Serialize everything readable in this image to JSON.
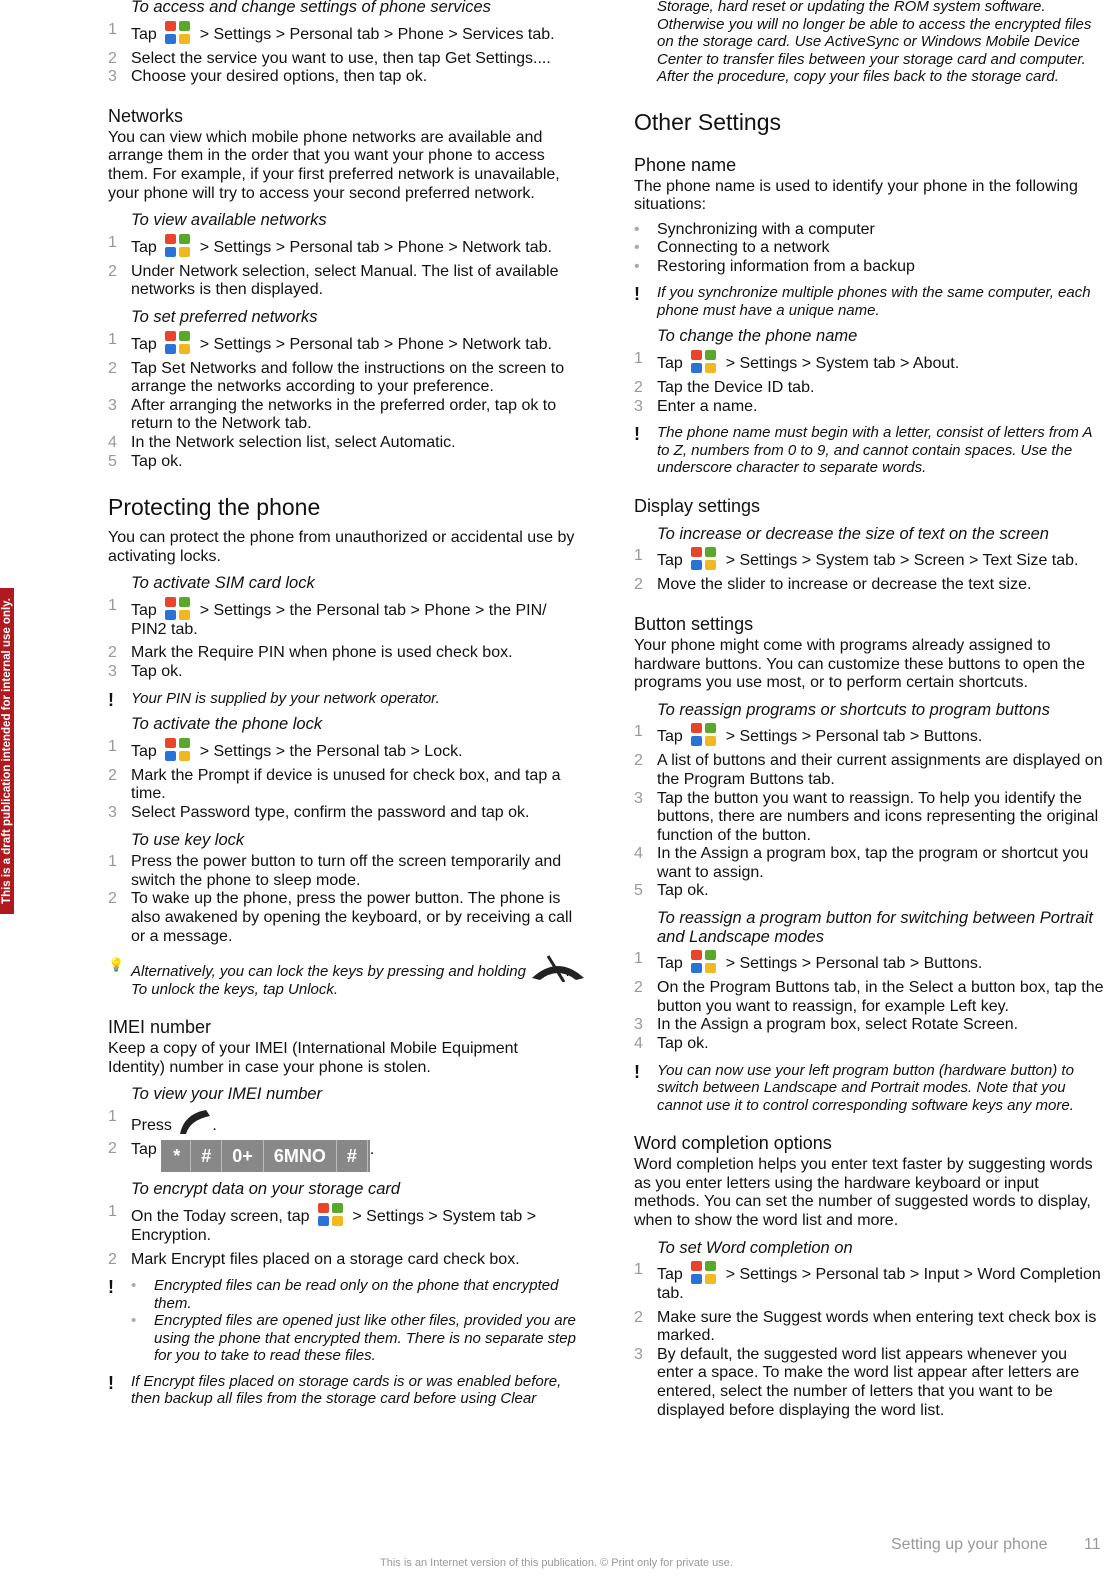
{
  "draft_banner": "This is a draft publication intended for internal use only.",
  "footer": {
    "section": "Setting up your phone",
    "page": "11",
    "note": "This is an Internet version of this publication. © Print only for private use."
  },
  "colors": {
    "draft": "#b01a1f",
    "muted": "#999999"
  },
  "left": [
    {
      "t": "task",
      "text": "To access and change settings of phone services",
      "first": true
    },
    {
      "t": "steps",
      "items": [
        [
          "Tap ",
          {
            "icon": "windows-start-icon"
          },
          " > Settings > Personal tab > Phone > Services tab."
        ],
        [
          "Select the service you want to use, then tap Get Settings...."
        ],
        [
          "Choose your desired options, then tap ok."
        ]
      ]
    },
    {
      "t": "h3",
      "text": "Networks"
    },
    {
      "t": "p",
      "text": "You can view which mobile phone networks are available and arrange them in the order that you want your phone to access them. For example, if your first preferred network is unavailable, your phone will try to access your second preferred network."
    },
    {
      "t": "task",
      "text": "To view available networks"
    },
    {
      "t": "steps",
      "items": [
        [
          "Tap ",
          {
            "icon": "windows-start-icon"
          },
          " > Settings > Personal tab > Phone > Network tab."
        ],
        [
          "Under Network selection, select Manual. The list of available networks is then displayed."
        ]
      ]
    },
    {
      "t": "task",
      "text": "To set preferred networks"
    },
    {
      "t": "steps",
      "items": [
        [
          "Tap ",
          {
            "icon": "windows-start-icon"
          },
          " > Settings > Personal tab > Phone > Network tab."
        ],
        [
          "Tap Set Networks and follow the instructions on the screen to arrange the networks according to your preference."
        ],
        [
          "After arranging the networks in the preferred order, tap ok to return to the Network tab."
        ],
        [
          "In the Network selection list, select Automatic."
        ],
        [
          "Tap ok."
        ]
      ]
    },
    {
      "t": "h2",
      "text": "Protecting the phone"
    },
    {
      "t": "p",
      "text": "You can protect the phone from unauthorized or accidental use by activating locks."
    },
    {
      "t": "task",
      "text": "To activate SIM card lock"
    },
    {
      "t": "steps",
      "items": [
        [
          "Tap ",
          {
            "icon": "windows-start-icon"
          },
          " > Settings > the Personal tab > Phone > the PIN/ PIN2 tab."
        ],
        [
          "Mark the Require PIN when phone is used check box."
        ],
        [
          "Tap ok."
        ]
      ]
    },
    {
      "t": "note",
      "text": "Your PIN is supplied by your network operator."
    },
    {
      "t": "task",
      "text": "To activate the phone lock"
    },
    {
      "t": "steps",
      "items": [
        [
          "Tap ",
          {
            "icon": "windows-start-icon"
          },
          " > Settings > the Personal tab > Lock."
        ],
        [
          "Mark the Prompt if device is unused for check box, and tap a time."
        ],
        [
          "Select Password type, confirm the password and tap ok."
        ]
      ]
    },
    {
      "t": "task",
      "text": "To use key lock"
    },
    {
      "t": "steps",
      "items": [
        [
          "Press the power button to turn off the screen temporarily and switch the phone to sleep mode."
        ],
        [
          "To wake up the phone, press the power button. The phone is also awakened by opening the keyboard, or by receiving a call or a message."
        ]
      ]
    },
    {
      "t": "tip",
      "parts": [
        "Alternatively, you can lock the keys by pressing and holding ",
        {
          "icon": "end-call-icon"
        },
        ". To unlock the keys, tap Unlock."
      ]
    },
    {
      "t": "h3",
      "text": "IMEI number"
    },
    {
      "t": "p",
      "text": "Keep a copy of your IMEI (International Mobile Equipment Identity) number in case your phone is stolen."
    },
    {
      "t": "task",
      "text": "To view your IMEI number"
    },
    {
      "t": "steps",
      "items": [
        [
          "Press ",
          {
            "icon": "call-icon"
          },
          "."
        ],
        [
          "Tap ",
          {
            "keys": [
              "*",
              "#",
              "0+",
              "6MNO",
              "#"
            ]
          },
          "."
        ]
      ]
    },
    {
      "t": "task",
      "text": "To encrypt data on your storage card"
    },
    {
      "t": "steps",
      "items": [
        [
          "On the Today screen, tap ",
          {
            "icon": "windows-start-icon"
          },
          " > Settings > System tab > Encryption."
        ],
        [
          "Mark Encrypt files placed on a storage card check box."
        ]
      ]
    },
    {
      "t": "note",
      "bullets": [
        "Encrypted files can be read only on the phone that encrypted them.",
        "Encrypted files are opened just like other files, provided you are using the phone that encrypted them. There is no separate step for you to take to read these files."
      ]
    },
    {
      "t": "note",
      "text": "If Encrypt files placed on storage cards is or was enabled before, then backup all files from the storage card before using Clear"
    }
  ],
  "right": [
    {
      "t": "cont",
      "text": "Storage, hard reset or updating the ROM system software. Otherwise you will no longer be able to access the encrypted files on the storage card. Use ActiveSync or Windows Mobile Device Center to transfer files between your storage card and computer. After the procedure, copy your files back to the storage card."
    },
    {
      "t": "h2",
      "text": "Other Settings"
    },
    {
      "t": "h3",
      "text": "Phone name"
    },
    {
      "t": "p",
      "text": "The phone name is used to identify your phone in the following situations:"
    },
    {
      "t": "bullets",
      "items": [
        "Synchronizing with a computer",
        "Connecting to a network",
        "Restoring information from a backup"
      ]
    },
    {
      "t": "note",
      "text": "If you synchronize multiple phones with the same computer, each phone must have a unique name."
    },
    {
      "t": "task",
      "text": "To change the phone name"
    },
    {
      "t": "steps",
      "items": [
        [
          "Tap ",
          {
            "icon": "windows-start-icon"
          },
          " > Settings > System tab > About."
        ],
        [
          "Tap the Device ID tab."
        ],
        [
          "Enter a name."
        ]
      ]
    },
    {
      "t": "note",
      "text": "The phone name must begin with a letter, consist of letters from A to Z, numbers from 0 to 9, and cannot contain spaces. Use the underscore character to separate words."
    },
    {
      "t": "h3",
      "text": "Display settings"
    },
    {
      "t": "task",
      "text": "To increase or decrease the size of text on the screen"
    },
    {
      "t": "steps",
      "items": [
        [
          "Tap ",
          {
            "icon": "windows-start-icon"
          },
          " > Settings > System tab > Screen > Text Size tab."
        ],
        [
          "Move the slider to increase or decrease the text size."
        ]
      ]
    },
    {
      "t": "h3",
      "text": "Button settings"
    },
    {
      "t": "p",
      "text": "Your phone might come with programs already assigned to hardware buttons. You can customize these buttons to open the programs you use most, or to perform certain shortcuts."
    },
    {
      "t": "task",
      "text": "To reassign programs or shortcuts to program buttons"
    },
    {
      "t": "steps",
      "items": [
        [
          "Tap ",
          {
            "icon": "windows-start-icon"
          },
          " > Settings > Personal tab > Buttons."
        ],
        [
          "A list of buttons and their current assignments are displayed on the Program Buttons tab."
        ],
        [
          "Tap the button you want to reassign. To help you identify the buttons, there are numbers and icons representing the original function of the button."
        ],
        [
          "In the Assign a program box, tap the program or shortcut you want to assign."
        ],
        [
          "Tap ok."
        ]
      ]
    },
    {
      "t": "task",
      "text": "To reassign a program button for switching between Portrait and Landscape modes"
    },
    {
      "t": "steps",
      "items": [
        [
          "Tap ",
          {
            "icon": "windows-start-icon"
          },
          " > Settings > Personal tab > Buttons."
        ],
        [
          "On the Program Buttons tab, in the Select a button box, tap the button you want to reassign, for example Left key."
        ],
        [
          "In the Assign a program box, select Rotate Screen."
        ],
        [
          "Tap ok."
        ]
      ]
    },
    {
      "t": "note",
      "text": "You can now use your left program button (hardware button) to switch between Landscape and Portrait modes. Note that you cannot use it to control corresponding software keys any more."
    },
    {
      "t": "h3",
      "text": "Word completion options"
    },
    {
      "t": "p",
      "text": "Word completion helps you enter text faster by suggesting words as you enter letters using the hardware keyboard or input methods. You can set the number of suggested words to display, when to show the word list and more."
    },
    {
      "t": "task",
      "text": "To set Word completion on"
    },
    {
      "t": "steps",
      "items": [
        [
          "Tap ",
          {
            "icon": "windows-start-icon"
          },
          " > Settings > Personal tab > Input > Word Completion tab."
        ],
        [
          "Make sure the Suggest words when entering text check box is marked."
        ],
        [
          "By default, the suggested word list appears whenever you enter a space. To make the word list appear after letters are entered, select the number of letters that you want to be displayed before displaying the word list."
        ]
      ]
    }
  ]
}
